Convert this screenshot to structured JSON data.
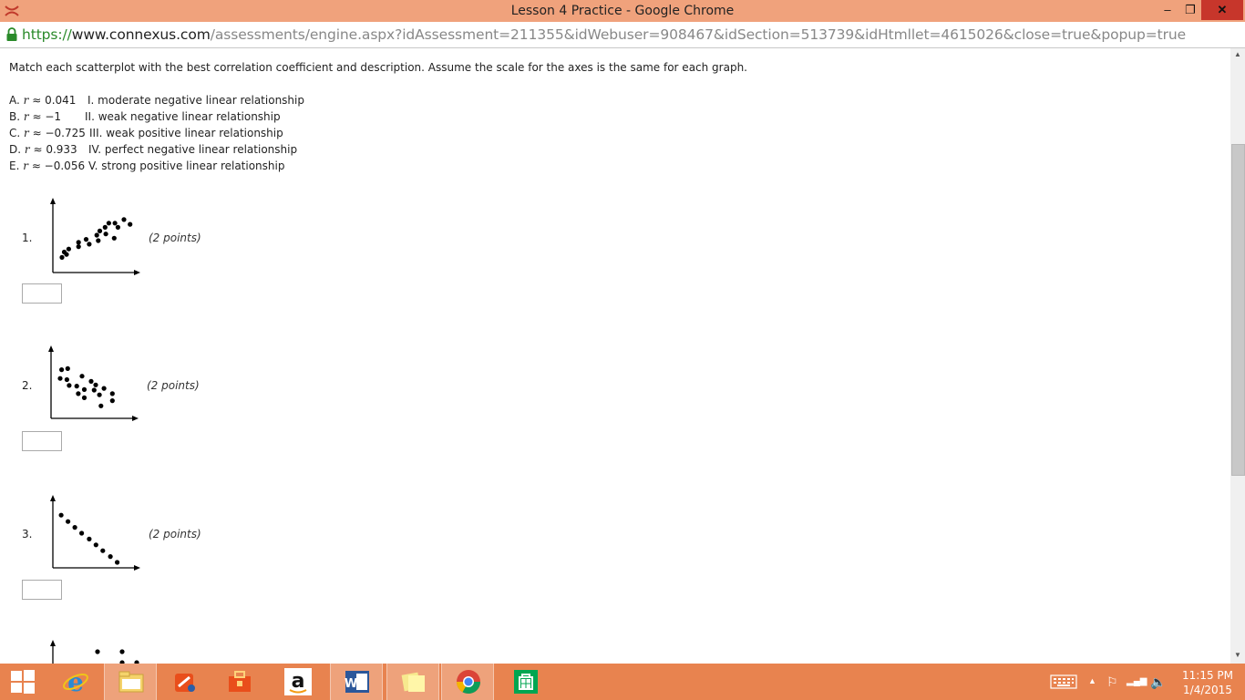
{
  "window": {
    "title": "Lesson 4 Practice - Google Chrome",
    "minimize_glyph": "–",
    "restore_glyph": "❐",
    "close_glyph": "✕"
  },
  "address": {
    "scheme": "https://",
    "host": "www.connexus.com",
    "path": "/assessments/engine.aspx?idAssessment=211355&idWebuser=908467&idSection=513739&idHtmllet=4615026&close=true&popup=true"
  },
  "instructions": "Match each scatterplot with the best correlation coefficient and description. Assume the scale for the axes is the same for each graph.",
  "coefficients": [
    {
      "letter": "A.",
      "var": "r",
      "value": "≈ 0.041"
    },
    {
      "letter": "B.",
      "var": "r",
      "value": "≈ −1"
    },
    {
      "letter": "C.",
      "var": "r",
      "value": "≈ −0.725"
    },
    {
      "letter": "D.",
      "var": "r",
      "value": "≈ 0.933"
    },
    {
      "letter": "E.",
      "var": "r",
      "value": "≈ −0.056"
    }
  ],
  "descriptions": [
    "I. moderate negative linear relationship",
    "II. weak negative linear relationship",
    "III. weak positive linear relationship",
    "IV. perfect negative linear relationship",
    "V. strong positive linear relationship"
  ],
  "questions": [
    {
      "number": "1.",
      "points": "(2 points)",
      "answer": ""
    },
    {
      "number": "2.",
      "points": "(2 points)",
      "answer": ""
    },
    {
      "number": "3.",
      "points": "(2 points)",
      "answer": ""
    }
  ],
  "chart_data": [
    {
      "type": "scatter",
      "title": "",
      "xlabel": "",
      "ylabel": "",
      "xlim": [
        0,
        10
      ],
      "ylim": [
        0,
        10
      ],
      "grid": false,
      "points": [
        [
          0.6,
          1.6
        ],
        [
          0.9,
          2.5
        ],
        [
          1.2,
          2.1
        ],
        [
          1.5,
          3.0
        ],
        [
          2.8,
          3.4
        ],
        [
          2.8,
          4.1
        ],
        [
          3.8,
          4.6
        ],
        [
          4.2,
          3.8
        ],
        [
          5.2,
          5.3
        ],
        [
          5.4,
          4.4
        ],
        [
          5.6,
          6.0
        ],
        [
          6.3,
          6.6
        ],
        [
          6.4,
          5.5
        ],
        [
          6.8,
          7.3
        ],
        [
          7.5,
          4.8
        ],
        [
          7.6,
          7.3
        ],
        [
          8.0,
          6.6
        ],
        [
          8.8,
          7.9
        ],
        [
          9.6,
          7.1
        ]
      ]
    },
    {
      "type": "scatter",
      "title": "",
      "xlabel": "",
      "ylabel": "",
      "xlim": [
        0,
        10
      ],
      "ylim": [
        0,
        10
      ],
      "grid": false,
      "points": [
        [
          0.6,
          5.9
        ],
        [
          0.8,
          7.4
        ],
        [
          1.6,
          7.6
        ],
        [
          1.5,
          5.7
        ],
        [
          1.8,
          4.7
        ],
        [
          2.8,
          4.6
        ],
        [
          3.0,
          3.3
        ],
        [
          3.5,
          6.3
        ],
        [
          3.8,
          4.0
        ],
        [
          3.8,
          2.6
        ],
        [
          4.7,
          5.4
        ],
        [
          5.1,
          3.9
        ],
        [
          5.3,
          4.8
        ],
        [
          5.8,
          3.1
        ],
        [
          6.0,
          1.2
        ],
        [
          6.4,
          4.2
        ],
        [
          7.5,
          2.1
        ],
        [
          7.5,
          3.3
        ]
      ]
    },
    {
      "type": "scatter",
      "title": "",
      "xlabel": "",
      "ylabel": "",
      "xlim": [
        0,
        10
      ],
      "ylim": [
        0,
        10
      ],
      "grid": false,
      "points": [
        [
          0.5,
          8.1
        ],
        [
          1.4,
          7.0
        ],
        [
          2.3,
          6.0
        ],
        [
          3.2,
          5.0
        ],
        [
          4.2,
          4.0
        ],
        [
          5.1,
          3.0
        ],
        [
          6.0,
          2.0
        ],
        [
          7.0,
          1.0
        ],
        [
          7.9,
          0.0
        ]
      ]
    }
  ],
  "taskbar": {
    "clock_time": "11:15 PM",
    "clock_date": "1/4/2015",
    "tray_up": "▲",
    "tray_flag": "⚐",
    "tray_signal": "▂▄▆",
    "tray_volume": "🔈"
  },
  "colors": {
    "titlebar": "#f0a27c",
    "taskbar": "#e8834f",
    "close_button": "#c7362b",
    "secure_scheme": "#2a8a2a"
  }
}
